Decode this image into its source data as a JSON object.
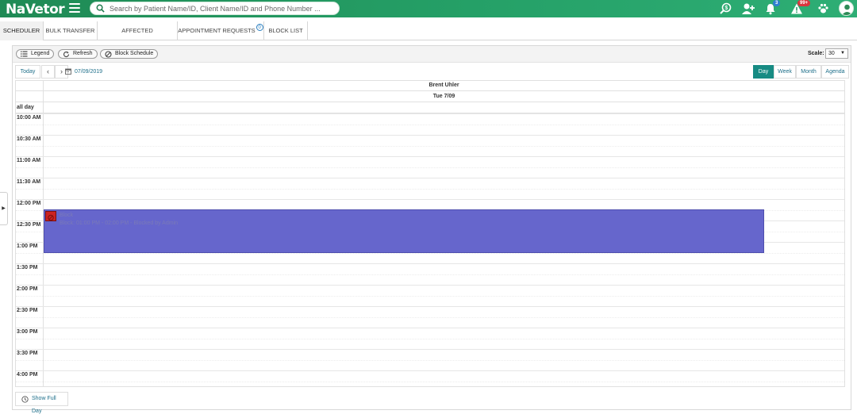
{
  "app": {
    "logo": "NaVetor"
  },
  "search": {
    "placeholder": "Search by Patient Name/ID, Client Name/ID and Phone Number ..."
  },
  "topbar": {
    "icons": [
      "search-dollar-icon",
      "add-user-icon",
      "bell-icon",
      "warning-icon",
      "paw-icon",
      "avatar-icon"
    ],
    "notifications_count": "3",
    "alerts_count": "99+",
    "colors": {
      "bar": "#25a067",
      "notif_badge": "#2f7fd1",
      "alert_badge": "#d9363e"
    }
  },
  "tabs": [
    {
      "label": "SCHEDULER",
      "active": true
    },
    {
      "label": "BULK TRANSFER"
    },
    {
      "label": "AFFECTED APPOINTMENTS"
    },
    {
      "label": "APPOINTMENT REQUESTS",
      "count": "0"
    },
    {
      "label": "BLOCK LIST"
    }
  ],
  "toolbar": {
    "legend_label": "Legend",
    "refresh_label": "Refresh",
    "block_label": "Block Schedule",
    "scale_label": "Scale:",
    "scale_value": "30"
  },
  "nav": {
    "today_label": "Today",
    "prev_label": "‹",
    "next_label": "›",
    "date": "07/09/2019",
    "views": [
      {
        "label": "Day",
        "active": true
      },
      {
        "label": "Week"
      },
      {
        "label": "Month"
      },
      {
        "label": "Agenda"
      }
    ]
  },
  "calendar": {
    "resource": "Brent Uhler",
    "day": "Tue 7/09",
    "allday_label": "all day",
    "times": [
      "10:00 AM",
      "10:30 AM",
      "11:00 AM",
      "11:30 AM",
      "12:00 PM",
      "12:30 PM",
      "1:00 PM",
      "1:30 PM",
      "2:00 PM",
      "2:30 PM",
      "3:00 PM",
      "3:30 PM",
      "4:00 PM"
    ],
    "appointment": {
      "title": "Block",
      "description": "Block: 01:00 PM - 02:00 PM - Blocked by Admin",
      "color": "#6666cc",
      "status_color": "#cc2222"
    }
  },
  "footer": {
    "show_full_day_label": "Show Full Day"
  },
  "side_handle": {
    "label": "▶"
  }
}
